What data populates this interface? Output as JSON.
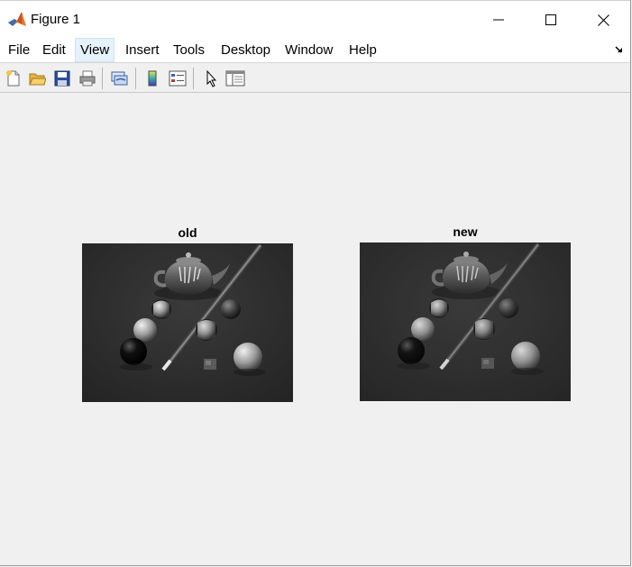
{
  "window": {
    "title": "Figure 1",
    "app_icon": "matlab-icon"
  },
  "window_controls": {
    "minimize_icon": "minimize-icon",
    "maximize_icon": "maximize-icon",
    "close_icon": "close-icon"
  },
  "menubar": {
    "items": [
      {
        "label": "File"
      },
      {
        "label": "Edit"
      },
      {
        "label": "View"
      },
      {
        "label": "Insert"
      },
      {
        "label": "Tools"
      },
      {
        "label": "Desktop"
      },
      {
        "label": "Window"
      },
      {
        "label": "Help"
      }
    ],
    "highlighted": "View",
    "dock_arrow_icon": "dock-arrow-icon"
  },
  "toolbar": {
    "buttons": [
      {
        "name": "new-figure",
        "icon": "new-file-icon"
      },
      {
        "name": "open-file",
        "icon": "open-folder-icon"
      },
      {
        "name": "save-figure",
        "icon": "save-icon"
      },
      {
        "name": "print-figure",
        "icon": "print-icon"
      },
      {
        "name": "link-plot",
        "icon": "link-plot-icon"
      },
      {
        "name": "insert-colorbar",
        "icon": "colorbar-icon"
      },
      {
        "name": "insert-legend",
        "icon": "legend-icon"
      },
      {
        "name": "edit-plot",
        "icon": "cursor-arrow-icon"
      },
      {
        "name": "property-inspector",
        "icon": "property-inspector-icon"
      }
    ]
  },
  "figure": {
    "axes": [
      {
        "title": "old",
        "image": "grayscale-pool-scene-original"
      },
      {
        "title": "new",
        "image": "grayscale-pool-scene-processed"
      }
    ]
  },
  "colors": {
    "titlebar_bg": "#ffffff",
    "figure_bg": "#f0f0f0",
    "menu_hover_bg": "#e5f1fb",
    "image_bg": "#303030"
  }
}
